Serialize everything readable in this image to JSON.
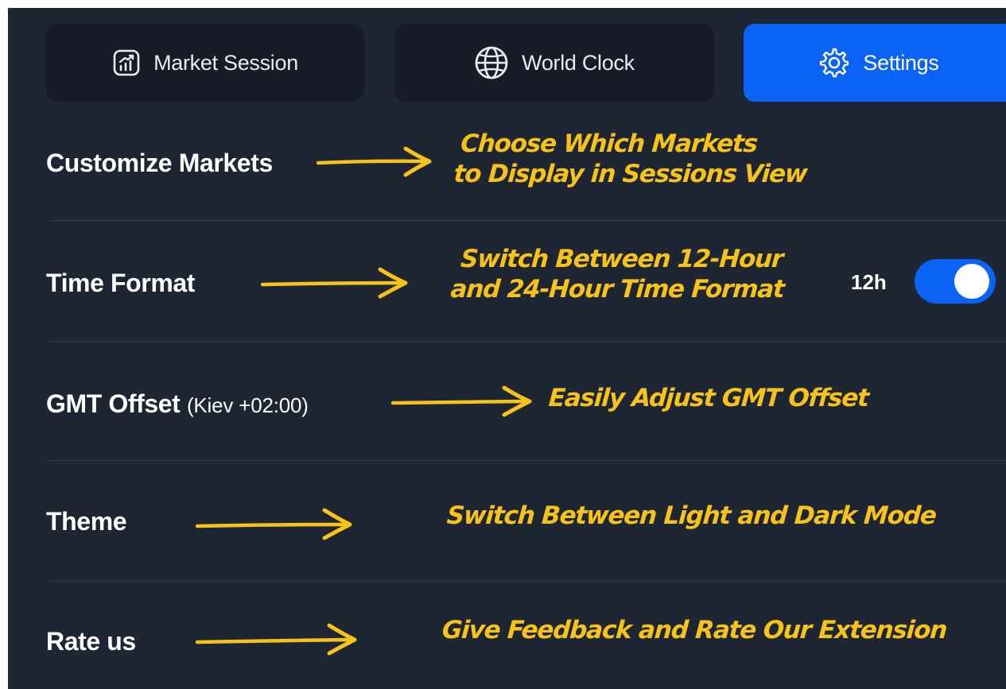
{
  "tabs": [
    {
      "label": "Market Session",
      "icon": "chart-icon",
      "active": false
    },
    {
      "label": "World Clock",
      "icon": "globe-icon",
      "active": false
    },
    {
      "label": "Settings",
      "icon": "gear-icon",
      "active": true
    }
  ],
  "settings": {
    "customize_markets": {
      "label": "Customize Markets",
      "annotation_line1": "Choose Which Markets",
      "annotation_line2": "to Display in Sessions View"
    },
    "time_format": {
      "label": "Time Format",
      "value_label": "12h",
      "toggle_on": true,
      "annotation_line1": "Switch Between 12-Hour",
      "annotation_line2": "and 24-Hour Time Format"
    },
    "gmt_offset": {
      "label": "GMT Offset",
      "sub_label": "(Kiev +02:00)",
      "annotation": "Easily Adjust GMT Offset"
    },
    "theme": {
      "label": "Theme",
      "annotation": "Switch Between Light and Dark Mode"
    },
    "rate_us": {
      "label": "Rate us",
      "annotation": "Give Feedback and Rate Our Extension"
    }
  },
  "colors": {
    "background": "#1e2533",
    "tab_background": "#171c27",
    "accent": "#0b63f6",
    "annotation": "#f7c21a",
    "divider": "#2f3748"
  }
}
